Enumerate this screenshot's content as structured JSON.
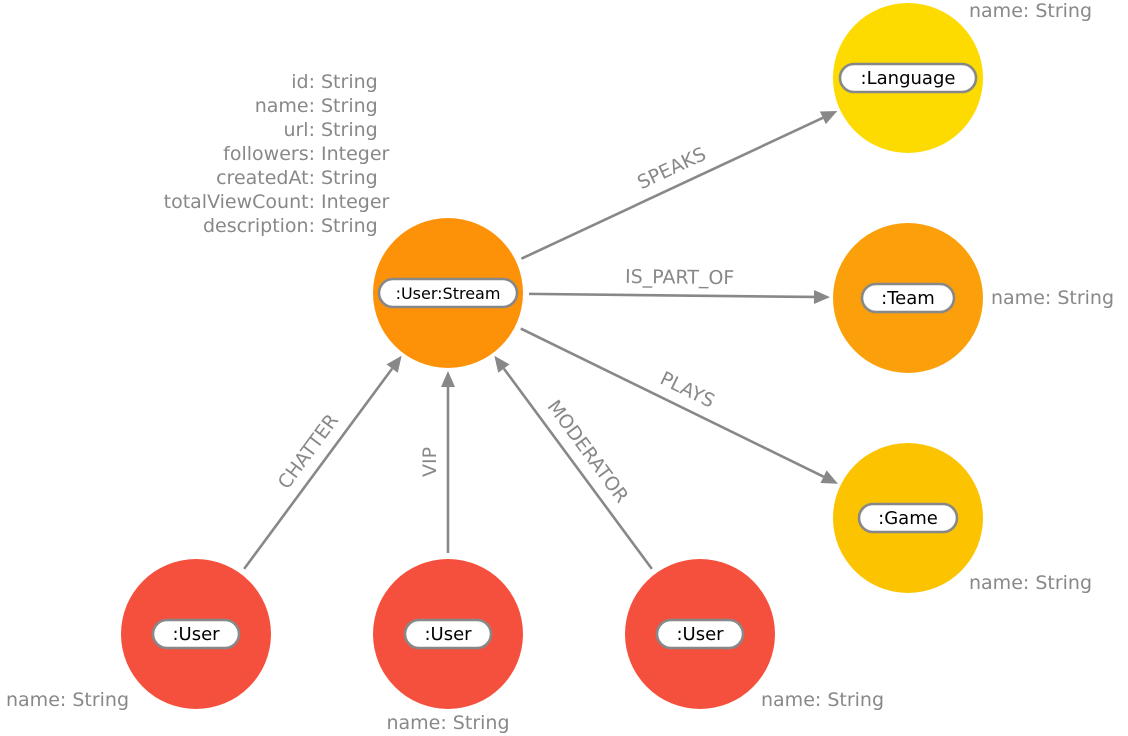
{
  "diagram": {
    "nodes": [
      {
        "id": "stream",
        "label": ":User:Stream",
        "color": "#FD9208",
        "properties": [
          "id: String",
          "name: String",
          "url: String",
          "followers: Integer",
          "createdAt: String",
          "totalViewCount: Integer",
          "description: String"
        ]
      },
      {
        "id": "language",
        "label": ":Language",
        "color": "#FDDA00",
        "properties": [
          "name: String"
        ]
      },
      {
        "id": "team",
        "label": ":Team",
        "color": "#FBA00A",
        "properties": [
          "name: String"
        ]
      },
      {
        "id": "game",
        "label": ":Game",
        "color": "#FCC400",
        "properties": [
          "name: String"
        ]
      },
      {
        "id": "user_chatter",
        "label": ":User",
        "color": "#F5503D",
        "properties": [
          "name: String"
        ]
      },
      {
        "id": "user_vip",
        "label": ":User",
        "color": "#F5503D",
        "properties": [
          "name: String"
        ]
      },
      {
        "id": "user_moderator",
        "label": ":User",
        "color": "#F5503D",
        "properties": [
          "name: String"
        ]
      }
    ],
    "edges": [
      {
        "from": "stream",
        "to": "language",
        "label": "SPEAKS"
      },
      {
        "from": "stream",
        "to": "team",
        "label": "IS_PART_OF"
      },
      {
        "from": "stream",
        "to": "game",
        "label": "PLAYS"
      },
      {
        "from": "user_chatter",
        "to": "stream",
        "label": "CHATTER"
      },
      {
        "from": "user_vip",
        "to": "stream",
        "label": "VIP"
      },
      {
        "from": "user_moderator",
        "to": "stream",
        "label": "MODERATOR"
      }
    ],
    "edge_color": "#888888",
    "text_color": "#888888"
  }
}
